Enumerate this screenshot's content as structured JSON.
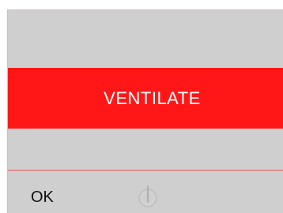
{
  "alarm": {
    "message": "VENTILATE",
    "background_color": "#ff1717",
    "text_color": "#ffffff"
  },
  "footer": {
    "ok_label": "OK",
    "control_icon": "rotary-knob-icon"
  },
  "theme": {
    "panel_background": "#cfcfcf",
    "divider_color": "#e38f8f"
  }
}
